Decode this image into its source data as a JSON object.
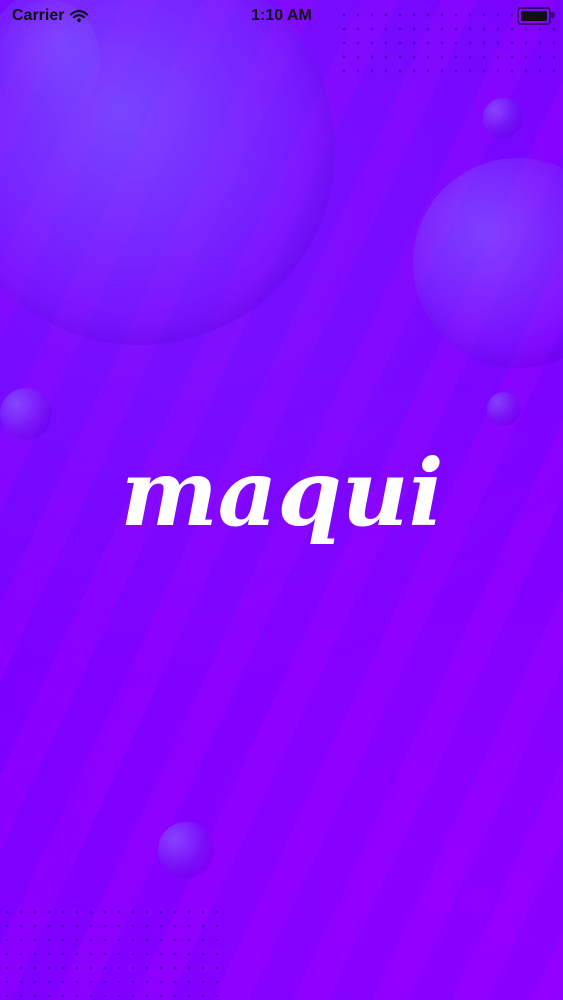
{
  "status_bar": {
    "carrier": "Carrier",
    "time": "1:10 AM",
    "wifi_icon": "wifi-icon",
    "battery_icon": "battery-icon",
    "battery_level": 1.0
  },
  "splash": {
    "brand_text": "maqui",
    "background_color": "#7a00ff",
    "brand_color": "#ffffff"
  }
}
